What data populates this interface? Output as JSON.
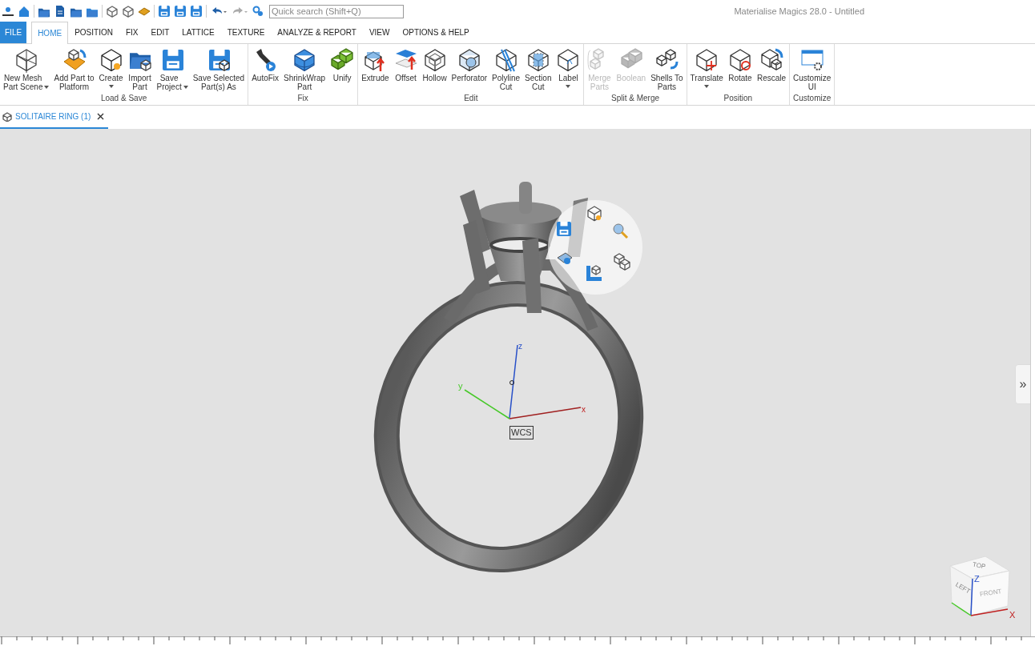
{
  "window": {
    "title": "Materialise Magics 28.0 - Untitled"
  },
  "quick_access": {
    "search": {
      "placeholder": "Quick search (Shift+Q)"
    }
  },
  "menu_tabs": [
    {
      "label": "FILE",
      "kind": "file",
      "selected": false
    },
    {
      "label": "HOME",
      "kind": "tab",
      "selected": true
    },
    {
      "label": "POSITION",
      "kind": "tab",
      "selected": false
    },
    {
      "label": "FIX",
      "kind": "tab",
      "selected": false
    },
    {
      "label": "EDIT",
      "kind": "tab",
      "selected": false
    },
    {
      "label": "LATTICE",
      "kind": "tab",
      "selected": false
    },
    {
      "label": "TEXTURE",
      "kind": "tab",
      "selected": false
    },
    {
      "label": "ANALYZE & REPORT",
      "kind": "tab",
      "selected": false
    },
    {
      "label": "VIEW",
      "kind": "tab",
      "selected": false
    },
    {
      "label": "OPTIONS & HELP",
      "kind": "tab",
      "selected": false
    }
  ],
  "ribbon": {
    "groups": [
      {
        "label": "Load & Save",
        "buttons": [
          {
            "label": "New Mesh\nPart Scene",
            "dropdown": true,
            "disabled": false
          },
          {
            "label": "Add Part to\nPlatform",
            "dropdown": false,
            "disabled": false
          },
          {
            "label": "Create",
            "dropdown": true,
            "disabled": false
          },
          {
            "label": "Import\nPart",
            "dropdown": false,
            "disabled": false
          },
          {
            "label": "Save\nProject",
            "dropdown": true,
            "disabled": false
          },
          {
            "label": "Save Selected\nPart(s) As",
            "dropdown": false,
            "disabled": false
          }
        ]
      },
      {
        "label": "Fix",
        "buttons": [
          {
            "label": "AutoFix",
            "dropdown": false,
            "disabled": false
          },
          {
            "label": "ShrinkWrap\nPart",
            "dropdown": false,
            "disabled": false
          },
          {
            "label": "Unify",
            "dropdown": false,
            "disabled": false
          }
        ]
      },
      {
        "label": "Edit",
        "buttons": [
          {
            "label": "Extrude",
            "dropdown": false,
            "disabled": false
          },
          {
            "label": "Offset",
            "dropdown": false,
            "disabled": false
          },
          {
            "label": "Hollow",
            "dropdown": false,
            "disabled": false
          },
          {
            "label": "Perforator",
            "dropdown": false,
            "disabled": false
          },
          {
            "label": "Polyline\nCut",
            "dropdown": false,
            "disabled": false
          },
          {
            "label": "Section\nCut",
            "dropdown": false,
            "disabled": false
          },
          {
            "label": "Label",
            "dropdown": true,
            "disabled": false
          }
        ]
      },
      {
        "label": "Split & Merge",
        "buttons": [
          {
            "label": "Merge\nParts",
            "dropdown": false,
            "disabled": true
          },
          {
            "label": "Boolean",
            "dropdown": false,
            "disabled": true
          },
          {
            "label": "Shells To\nParts",
            "dropdown": false,
            "disabled": false
          }
        ]
      },
      {
        "label": "Position",
        "buttons": [
          {
            "label": "Translate",
            "dropdown": true,
            "disabled": false
          },
          {
            "label": "Rotate",
            "dropdown": false,
            "disabled": false
          },
          {
            "label": "Rescale",
            "dropdown": false,
            "disabled": false
          }
        ]
      },
      {
        "label": "Customize",
        "buttons": [
          {
            "label": "Customize\nUI",
            "dropdown": false,
            "disabled": false
          }
        ]
      }
    ]
  },
  "document_tabs": [
    {
      "label": "SOLITAIRE RING (1)",
      "selected": true
    }
  ],
  "viewport": {
    "axes": {
      "z": "z",
      "y": "y",
      "x": "x"
    },
    "coordinate_label": "WCS",
    "view_cube": {
      "top": "TOP",
      "left": "LEFT",
      "front": "FRONT",
      "z": "Z",
      "x": "X"
    },
    "panel_toggle": "»"
  }
}
